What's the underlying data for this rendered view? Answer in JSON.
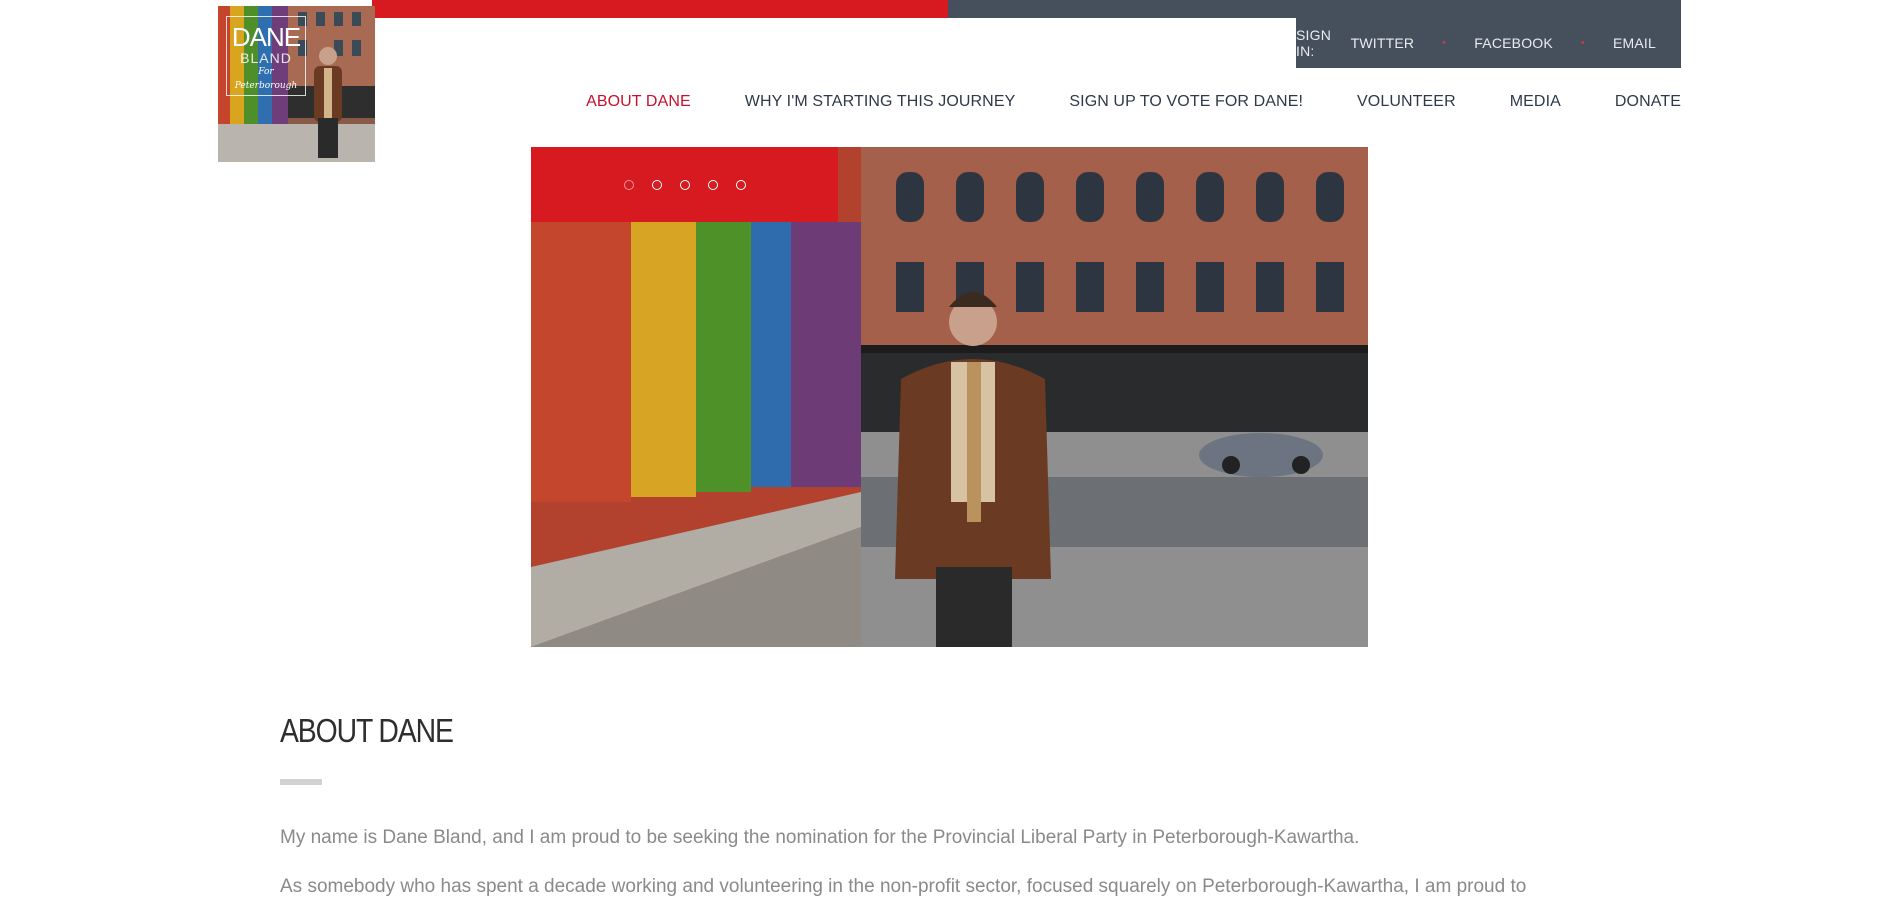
{
  "topbar": {
    "signin_label": "SIGN IN:",
    "links": [
      "TWITTER",
      "FACEBOOK",
      "EMAIL"
    ],
    "dot": "•"
  },
  "logo": {
    "name_line1": "DANE",
    "name_line2": "BLAND",
    "tagline": "For Peterborough"
  },
  "nav": {
    "items": [
      "ABOUT DANE",
      "WHY I'M STARTING THIS JOURNEY",
      "SIGN UP TO VOTE FOR DANE!",
      "VOLUNTEER",
      "MEDIA",
      "DONATE"
    ],
    "active_index": 0
  },
  "slider": {
    "slide_count": 5,
    "active_index": 0
  },
  "content": {
    "heading": "ABOUT DANE",
    "paragraph_1": "My name is Dane Bland, and I am proud to be seeking the nomination for the Provincial Liberal Party in Peterborough-Kawartha.",
    "paragraph_2": "As somebody who has spent a decade working and volunteering in the non-profit sector, focused squarely on Peterborough-Kawartha, I am proud to"
  },
  "colors": {
    "accent_red": "#d71920",
    "slate": "#46505c",
    "nav_text": "#2d3a4a",
    "active_nav": "#c8102e",
    "body_text": "#8a8a8a"
  }
}
